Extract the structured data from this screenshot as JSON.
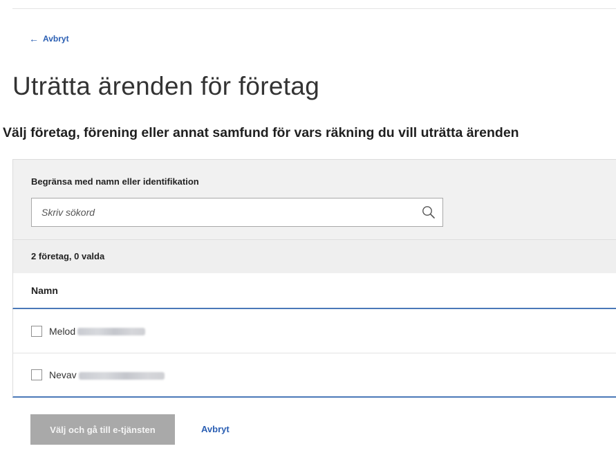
{
  "nav": {
    "back_arrow": "←",
    "back_label": "Avbryt"
  },
  "page": {
    "title": "Uträtta ärenden för företag",
    "subtitle": "Välj företag, förening eller annat samfund för vars räkning du vill uträtta ärenden"
  },
  "filter": {
    "label": "Begränsa med namn eller identifikation",
    "placeholder": "Skriv sökord",
    "value": "",
    "icon": "search-icon"
  },
  "summary": {
    "count_text": "2 företag, 0 valda"
  },
  "table": {
    "columns": [
      "Namn"
    ],
    "rows": [
      {
        "name_visible": "Melod",
        "checked": false,
        "redacted": true
      },
      {
        "name_visible": "Nevav",
        "checked": false,
        "redacted": true
      }
    ]
  },
  "actions": {
    "primary_label": "Välj och gå till e-tjänsten",
    "primary_enabled": false,
    "cancel_label": "Avbryt"
  },
  "colors": {
    "link": "#2b5fb3",
    "accent_border": "#4a78b8",
    "panel_bg": "#f1f1f1",
    "button_disabled": "#a9a9a9"
  }
}
